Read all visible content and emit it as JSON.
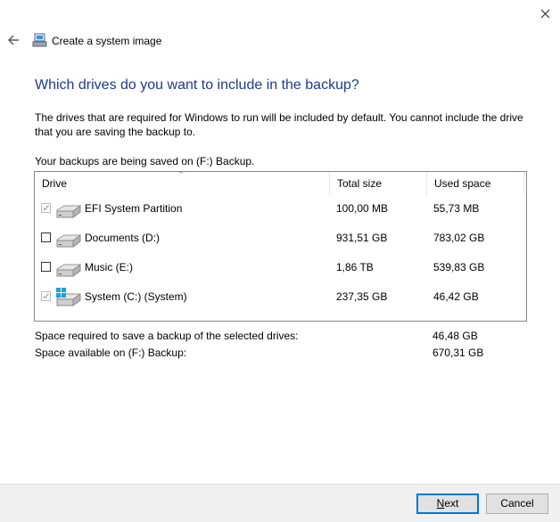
{
  "window": {
    "title": "Create a system image"
  },
  "heading": "Which drives do you want to include in the backup?",
  "description": "The drives that are required for Windows to run will be included by default. You cannot include the drive that you are saving the backup to.",
  "saved_location": "Your backups are being saved on (F:) Backup.",
  "table": {
    "columns": {
      "drive": "Drive",
      "total": "Total size",
      "used": "Used space"
    },
    "rows": [
      {
        "name": "EFI System Partition",
        "total": "100,00 MB",
        "used": "55,73 MB",
        "checked": true,
        "disabled": true,
        "icon": "drive-icon"
      },
      {
        "name": "Documents (D:)",
        "total": "931,51 GB",
        "used": "783,02 GB",
        "checked": false,
        "disabled": false,
        "icon": "drive-icon"
      },
      {
        "name": "Music (E:)",
        "total": "1,86 TB",
        "used": "539,83 GB",
        "checked": false,
        "disabled": false,
        "icon": "drive-icon"
      },
      {
        "name": "System (C:) (System)",
        "total": "237,35 GB",
        "used": "46,42 GB",
        "checked": true,
        "disabled": true,
        "icon": "windows-drive-icon"
      }
    ]
  },
  "summary": {
    "required_label": "Space required to save a backup of the selected drives:",
    "required_value": "46,48 GB",
    "available_label": "Space available on (F:) Backup:",
    "available_value": "670,31 GB"
  },
  "buttons": {
    "next_first": "N",
    "next_rest": "ext",
    "cancel": "Cancel"
  },
  "colors": {
    "heading": "#1e3b8a",
    "accent": "#0078d7"
  }
}
